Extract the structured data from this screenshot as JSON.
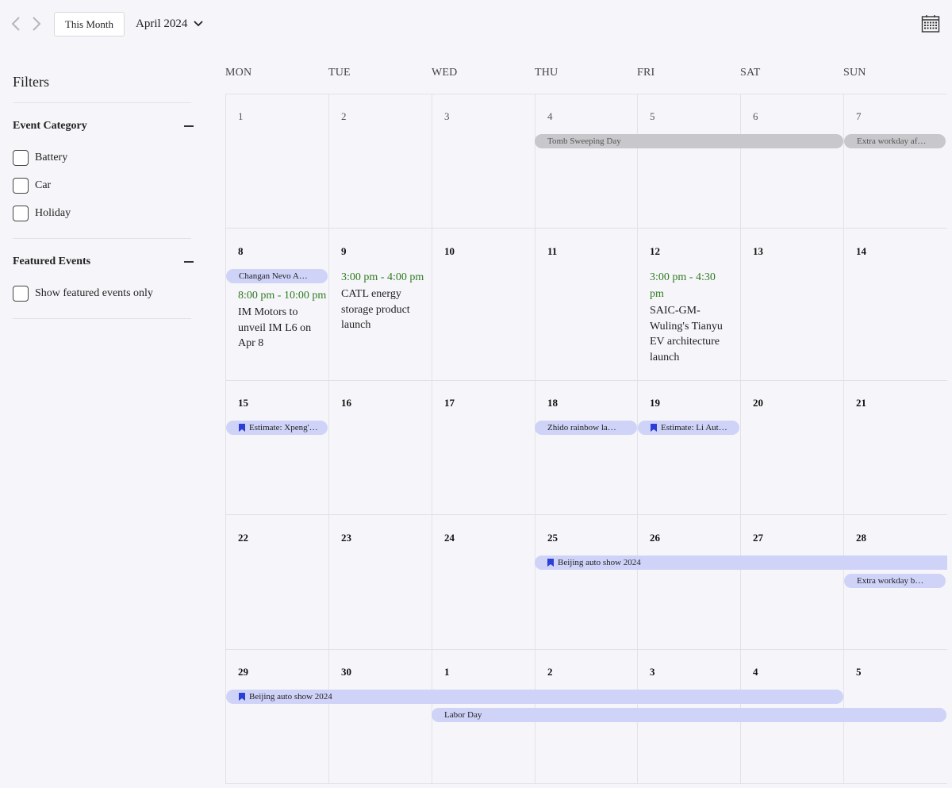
{
  "toolbar": {
    "this_month_label": "This Month",
    "month_label": "April 2024"
  },
  "sidebar": {
    "title": "Filters",
    "event_category": {
      "title": "Event Category",
      "options": [
        "Battery",
        "Car",
        "Holiday"
      ]
    },
    "featured": {
      "title": "Featured Events",
      "option": "Show featured events only"
    }
  },
  "calendar": {
    "weekdays": [
      "MON",
      "TUE",
      "WED",
      "THU",
      "FRI",
      "SAT",
      "SUN"
    ],
    "weeks": [
      [
        "1",
        "2",
        "3",
        "4",
        "5",
        "6",
        "7"
      ],
      [
        "8",
        "9",
        "10",
        "11",
        "12",
        "13",
        "14"
      ],
      [
        "15",
        "16",
        "17",
        "18",
        "19",
        "20",
        "21"
      ],
      [
        "22",
        "23",
        "24",
        "25",
        "26",
        "27",
        "28"
      ],
      [
        "29",
        "30",
        "1",
        "2",
        "3",
        "4",
        "5"
      ]
    ],
    "events": {
      "tomb_sweeping": "Tomb Sweeping Day",
      "extra_workday_1": "Extra workday af…",
      "changan": "Changan Nevo A…",
      "im_motors_time": "8:00 pm - 10:00 pm",
      "im_motors_title": "IM Motors to unveil IM L6 on Apr 8",
      "catl_time": "3:00 pm - 4:00 pm",
      "catl_title": "CATL energy storage product launch",
      "saic_time": "3:00 pm - 4:30 pm",
      "saic_title": "SAIC-GM-Wuling's Tianyu EV architecture launch",
      "xpeng": "Estimate: Xpeng'…",
      "zhido": "Zhido rainbow la…",
      "li_auto": "Estimate: Li Aut…",
      "beijing_show": "Beijing auto show 2024",
      "extra_workday_2": "Extra workday b…",
      "labor_day": "Labor Day"
    }
  },
  "colors": {
    "accent_blue": "#2b3fd6",
    "pill_blue": "#cfd3f8",
    "pill_gray": "#c8c8cc",
    "time_green": "#2f7a1f"
  }
}
